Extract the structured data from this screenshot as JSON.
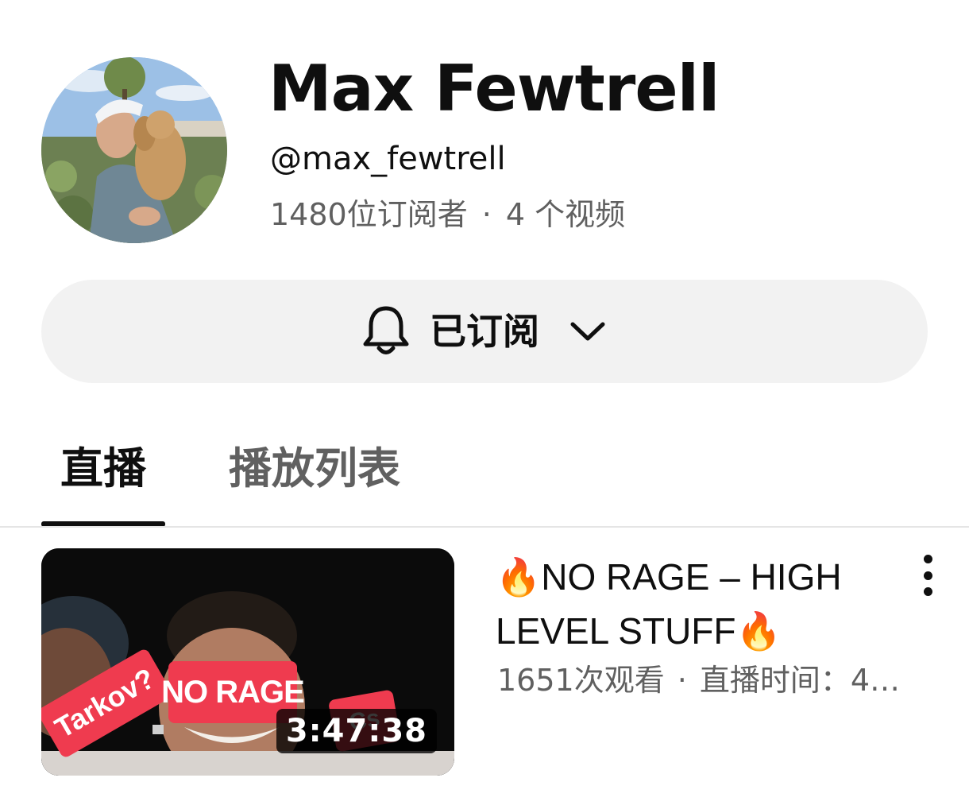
{
  "channel": {
    "name": "Max Fewtrell",
    "handle": "@max_fewtrell",
    "subscribers": "1480位订阅者",
    "separator": "·",
    "video_count": "4 个视频",
    "avatar_icon": "channel-avatar"
  },
  "subscribe": {
    "label": "已订阅",
    "bell_icon": "bell-icon",
    "dropdown_icon": "chevron-down-icon",
    "background": "#f2f2f2"
  },
  "tabs": [
    {
      "label": "直播",
      "selected": true
    },
    {
      "label": "播放列表",
      "selected": false
    }
  ],
  "videos": [
    {
      "title": "🔥NO RAGE – HIGH LEVEL STUFF🔥",
      "views": "1651次观看",
      "separator": "·",
      "streamed": "直播时间：4…",
      "duration": "3:47:38",
      "thumbnail_stickers": [
        "Tarkov?",
        "NO RAGE",
        "Cs"
      ],
      "more_icon": "more-vert-icon"
    }
  ]
}
